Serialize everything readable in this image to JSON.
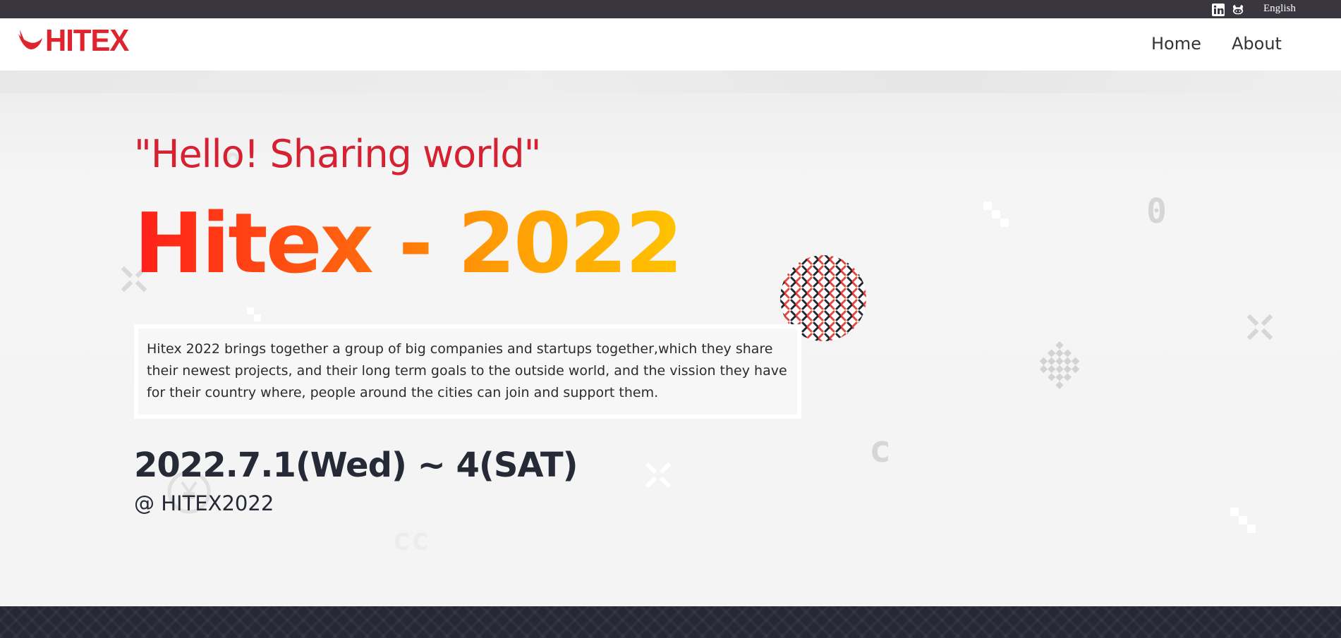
{
  "topbar": {
    "icons": [
      "linkedin-icon",
      "github-icon"
    ],
    "language": "English"
  },
  "nav": {
    "logo_text": "HITEX",
    "links": [
      "Home",
      "About"
    ]
  },
  "hero": {
    "tagline": "\"Hello! Sharing world\"",
    "title": "Hitex - 2022",
    "description": "Hitex 2022 brings together a group of big companies and startups together,which they share their newest projects, and their long term goals to the outside world, and the vission they have for their country where, people around the cities can join and support them.",
    "date": "2022.7.1(Wed) ~ 4(SAT)",
    "venue": "@ HITEX2022"
  },
  "colors": {
    "brand_red": "#e0242d",
    "tagline_red": "#d52232",
    "title_gradient": [
      "#ff1f1a",
      "#ffc300"
    ],
    "dark_text": "#262a36",
    "topbar_bg": "#3a3640",
    "footer_bg": "#262833"
  }
}
